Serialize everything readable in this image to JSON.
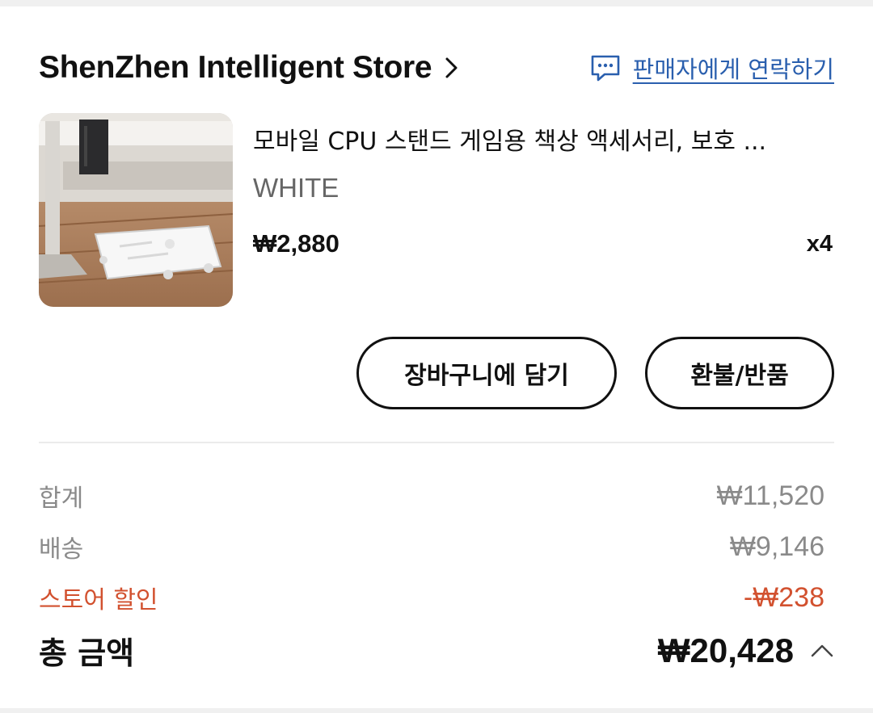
{
  "store": {
    "name": "ShenZhen Intelligent Store",
    "contact_label": "판매자에게 연락하기"
  },
  "product": {
    "title": "모바일 CPU 스탠드 게임용 책상 액세서리, 보호 ...",
    "variant": "WHITE",
    "price": "₩2,880",
    "quantity": "x4"
  },
  "actions": {
    "add_to_cart": "장바구니에 담기",
    "refund_return": "환불/반품"
  },
  "summary": {
    "subtotal_label": "합계",
    "subtotal_value": "₩11,520",
    "shipping_label": "배송",
    "shipping_value": "₩9,146",
    "discount_label": "스토어 할인",
    "discount_value": "-₩238",
    "total_label": "총 금액",
    "total_value": "₩20,428"
  },
  "colors": {
    "link_blue": "#2a5fae",
    "discount_red": "#d2512f",
    "muted_gray": "#8a8a8a"
  },
  "icons": {
    "store_chevron": "chevron-right-icon",
    "contact": "chat-bubble-icon",
    "summary_toggle": "chevron-up-icon"
  }
}
